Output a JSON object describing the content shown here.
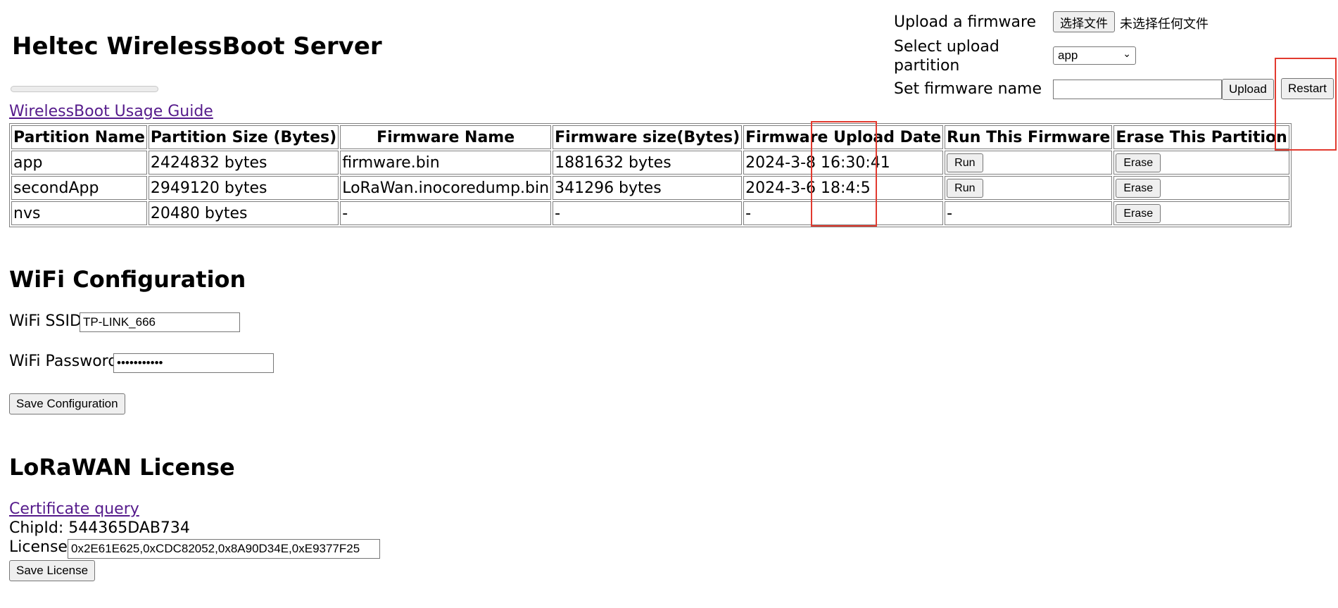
{
  "header": {
    "title": "Heltec WirelessBoot Server",
    "guide_link": "WirelessBoot Usage Guide"
  },
  "upload": {
    "upload_label": "Upload a firmware",
    "choose_file_button": "选择文件",
    "no_file_text": "未选择任何文件",
    "partition_label": "Select upload partition",
    "partition_selected": "app",
    "firmware_name_label": "Set firmware name",
    "firmware_name_value": "",
    "upload_button": "Upload",
    "restart_button": "Restart"
  },
  "table": {
    "headers": [
      "Partition Name",
      "Partition Size (Bytes)",
      "Firmware Name",
      "Firmware size(Bytes)",
      "Firmware Upload Date",
      "Run This Firmware",
      "Erase This Partition"
    ],
    "rows": [
      {
        "partition": "app",
        "size": "2424832 bytes",
        "firmware": "firmware.bin",
        "fw_size": "1881632 bytes",
        "date": "2024-3-8 16:30:41",
        "run": "Run",
        "erase": "Erase"
      },
      {
        "partition": "secondApp",
        "size": "2949120 bytes",
        "firmware": "LoRaWan.inocoredump.bin",
        "fw_size": "341296 bytes",
        "date": "2024-3-6 18:4:5",
        "run": "Run",
        "erase": "Erase"
      },
      {
        "partition": "nvs",
        "size": "20480 bytes",
        "firmware": "-",
        "fw_size": "-",
        "date": "-",
        "run": "-",
        "erase": "Erase"
      }
    ]
  },
  "wifi": {
    "heading": "WiFi Configuration",
    "ssid_label": "WiFi SSID:",
    "ssid_value": "TP-LINK_666",
    "password_label": "WiFi Password:",
    "password_value": "•••••••••••",
    "save_button": "Save Configuration"
  },
  "license": {
    "heading": "LoRaWAN License",
    "cert_link": "Certificate query",
    "chipid_label": "ChipId: 544365DAB734",
    "license_label": "License:",
    "license_value": "0x2E61E625,0xCDC82052,0x8A90D34E,0xE9377F25",
    "save_button": "Save License"
  },
  "colors": {
    "highlight": "#e23a2f",
    "link": "#551a8b"
  }
}
